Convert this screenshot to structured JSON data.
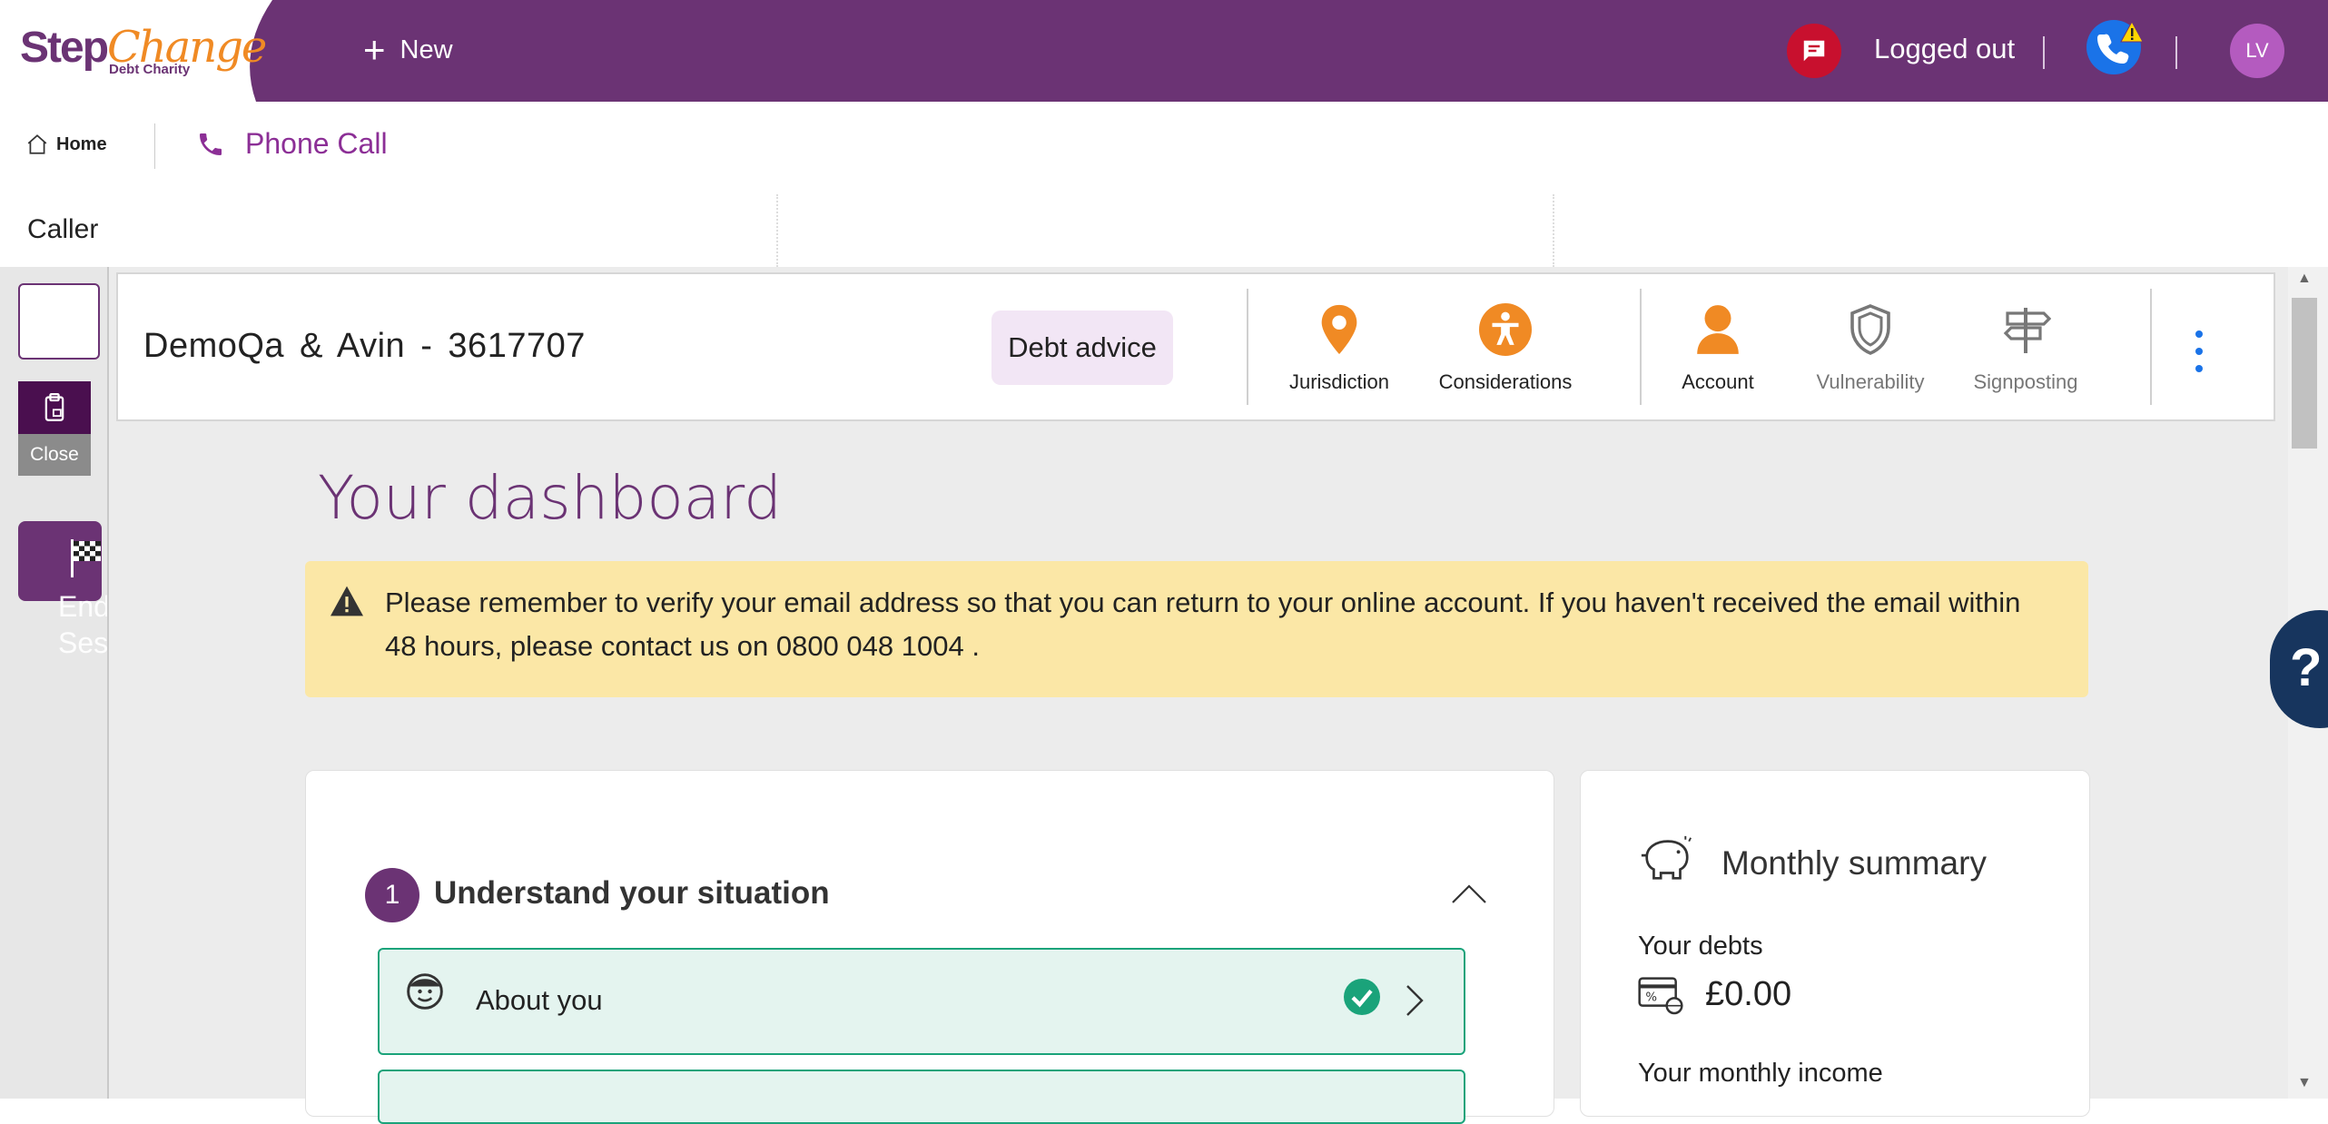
{
  "brand": {
    "step": "Step",
    "change": "Change",
    "sub": "Debt Charity"
  },
  "header": {
    "new_label": "New",
    "status_label": "Logged out",
    "avatar_initials": "LV"
  },
  "nav": {
    "home_label": "Home",
    "phone_call_label": "Phone Call"
  },
  "caller": {
    "label": "Caller"
  },
  "rail": {
    "close_label": "Close",
    "end_label": "End Session"
  },
  "client": {
    "name": "DemoQa & Avin - 3617707",
    "badge": "Debt advice",
    "tools": [
      {
        "label": "Jurisdiction",
        "icon": "location-pin-icon"
      },
      {
        "label": "Considerations",
        "icon": "accessibility-icon"
      },
      {
        "label": "Account",
        "icon": "person-icon"
      },
      {
        "label": "Vulnerability",
        "icon": "shield-icon"
      },
      {
        "label": "Signposting",
        "icon": "signpost-icon"
      }
    ]
  },
  "dashboard": {
    "title": "Your dashboard",
    "alert": "Please remember to verify your email address so that you can return to your online account. If you haven't received the email within 48 hours, please contact us on 0800 048 1004 .",
    "step": {
      "number": "1",
      "title": "Understand your situation"
    },
    "items": [
      {
        "label": "About you",
        "status": "complete"
      }
    ]
  },
  "summary": {
    "title": "Monthly summary",
    "debts_label": "Your debts",
    "debts_value": "£0.00",
    "income_label": "Your monthly income"
  },
  "help": {
    "label": "?"
  },
  "colors": {
    "brand_purple": "#6b3374",
    "accent_orange": "#f08a24",
    "success_green": "#1aa37a",
    "alert_yellow": "#fbe7a6",
    "chat_red": "#c8102e"
  }
}
